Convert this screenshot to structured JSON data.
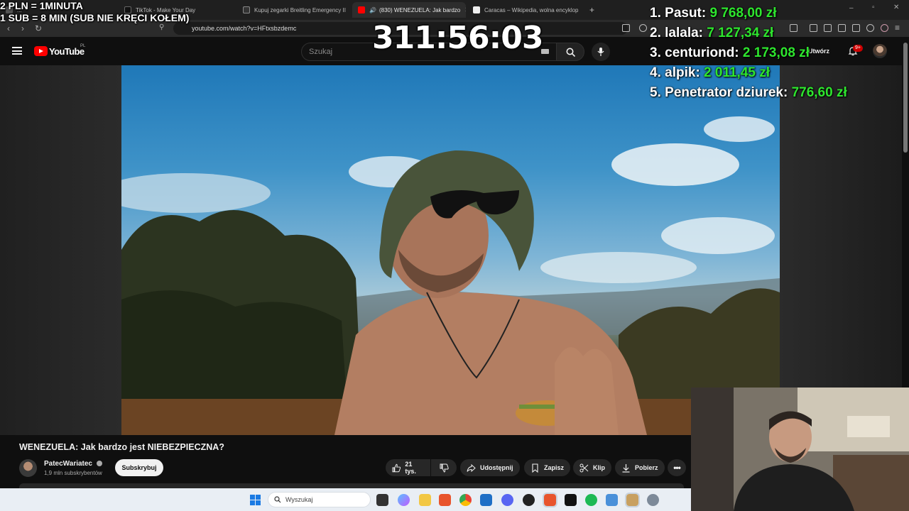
{
  "browser": {
    "tabs": [
      {
        "label": "...",
        "active": false
      },
      {
        "label": "TikTok - Make Your Day",
        "active": false
      },
      {
        "label": "Kupuj zegarki Breitling Emergency II",
        "active": false
      },
      {
        "label": "(830) WENEZUELA: Jak bardzo",
        "active": true
      },
      {
        "label": "Caracas – Wikipedia, wolna encyklop",
        "active": false
      }
    ],
    "new_tab": "+",
    "url": "youtube.com/watch?v=HFtxsbzdemc"
  },
  "youtube": {
    "logo_text": "YouTube",
    "country": "PL",
    "search_placeholder": "Szukaj",
    "create_label": "Utwórz",
    "notifications_badge": "9+",
    "video": {
      "title": "WENEZUELA: Jak bardzo jest NIEBEZPIECZNA?"
    },
    "channel": {
      "name": "PatecWariatec",
      "subscribers": "1,9 mln subskrybentów",
      "subscribe_label": "Subskrybuj"
    },
    "actions": {
      "likes": "21 tys.",
      "share": "Udostępnij",
      "save": "Zapisz",
      "clip": "Klip",
      "download": "Pobierz"
    }
  },
  "taskbar": {
    "search_placeholder": "Wyszukaj"
  },
  "stream_overlay": {
    "donation_rules": [
      "2 PLN = 1MINUTA",
      "1 SUB = 8 MIN (SUB NIE KRĘCI KOŁEM)"
    ],
    "timer": "311:56:03",
    "leaderboard": [
      {
        "rank": "1.",
        "name": "Pasut:",
        "amount": "9 768,00 zł"
      },
      {
        "rank": "2.",
        "name": "lalala:",
        "amount": "7 127,34 zł"
      },
      {
        "rank": "3.",
        "name": "centuriond:",
        "amount": "2 173,08 zł"
      },
      {
        "rank": "4.",
        "name": "alpik:",
        "amount": "2 011,45 zł"
      },
      {
        "rank": "5.",
        "name": "Penetrator dziurek:",
        "amount": "776,60 zł"
      }
    ],
    "amount_color": "#2ee52e"
  },
  "colors": {
    "youtube_red": "#ff0000",
    "background": "#0f0f0f",
    "pill_bg": "#272727"
  }
}
